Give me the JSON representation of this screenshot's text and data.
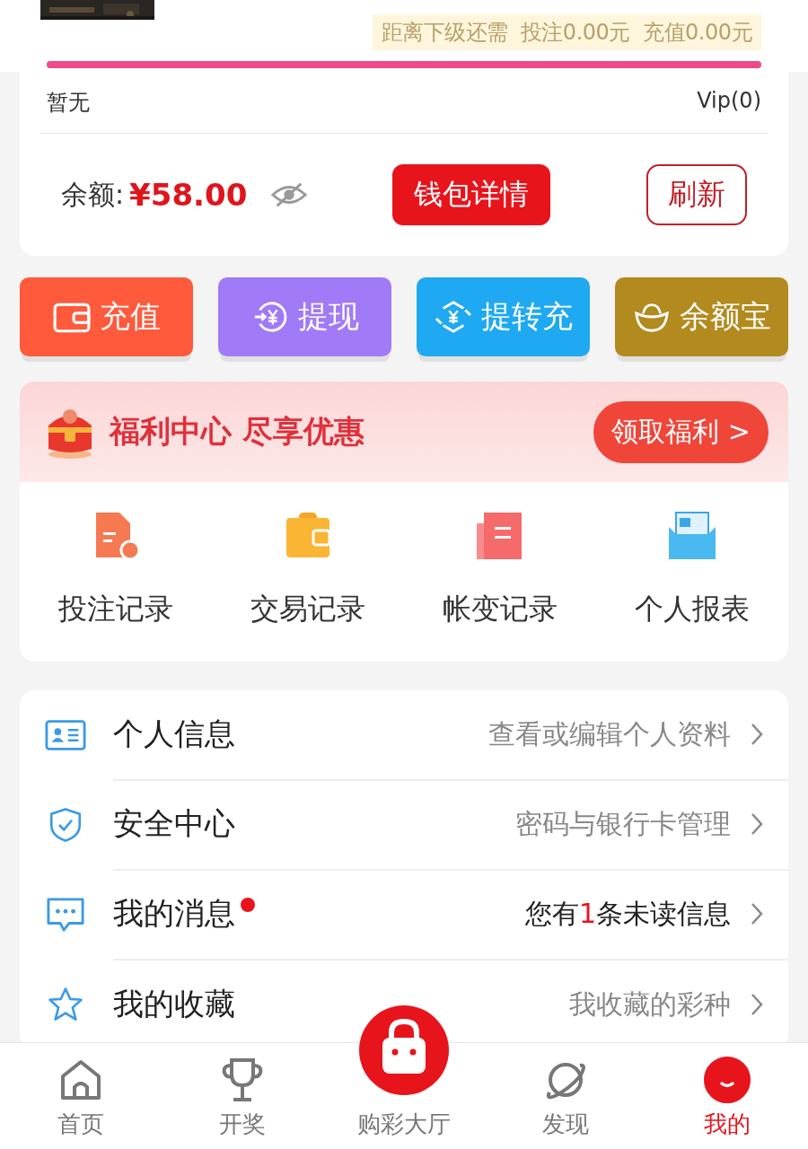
{
  "level_info": {
    "note": "距离下级还需  投注0.00元  充值0.00元",
    "level": 1
  },
  "vip": {
    "title": "暂无",
    "vip": "Vip(0)"
  },
  "balance": {
    "label": "余额:",
    "amount": "¥58.00",
    "hidden": false,
    "wallet_button": "钱包详情",
    "refresh_button": "刷新"
  },
  "actions": [
    {
      "label": "充值",
      "color": "#ff5a3c"
    },
    {
      "label": "提现",
      "color": "#a07af7"
    },
    {
      "label": "提转充",
      "color": "#1fa9f2"
    },
    {
      "label": "余额宝",
      "color": "#b28a1e"
    }
  ],
  "welfare": {
    "title": "福利中心 尽享优惠",
    "button": "领取福利 >"
  },
  "records": [
    {
      "label": "投注记录"
    },
    {
      "label": "交易记录"
    },
    {
      "label": "帐变记录"
    },
    {
      "label": "个人报表"
    }
  ],
  "menu": [
    {
      "title": "个人信息",
      "detail": "查看或编辑个人资料",
      "badge": false
    },
    {
      "title": "安全中心",
      "detail": "密码与银行卡管理",
      "badge": false
    },
    {
      "title": "我的消息",
      "detail": "您有",
      "count": "1",
      "detail_after": "条未读信息",
      "badge": true
    },
    {
      "title": "我的收藏",
      "detail": "我收藏的彩种",
      "badge": false
    }
  ],
  "tabs": [
    {
      "label": "首页",
      "selected": false
    },
    {
      "label": "开奖",
      "selected": false
    },
    {
      "label": "购彩大厅",
      "selected": false,
      "kind": "center"
    },
    {
      "label": "发现",
      "selected": false
    },
    {
      "label": "我的",
      "selected": true
    }
  ]
}
